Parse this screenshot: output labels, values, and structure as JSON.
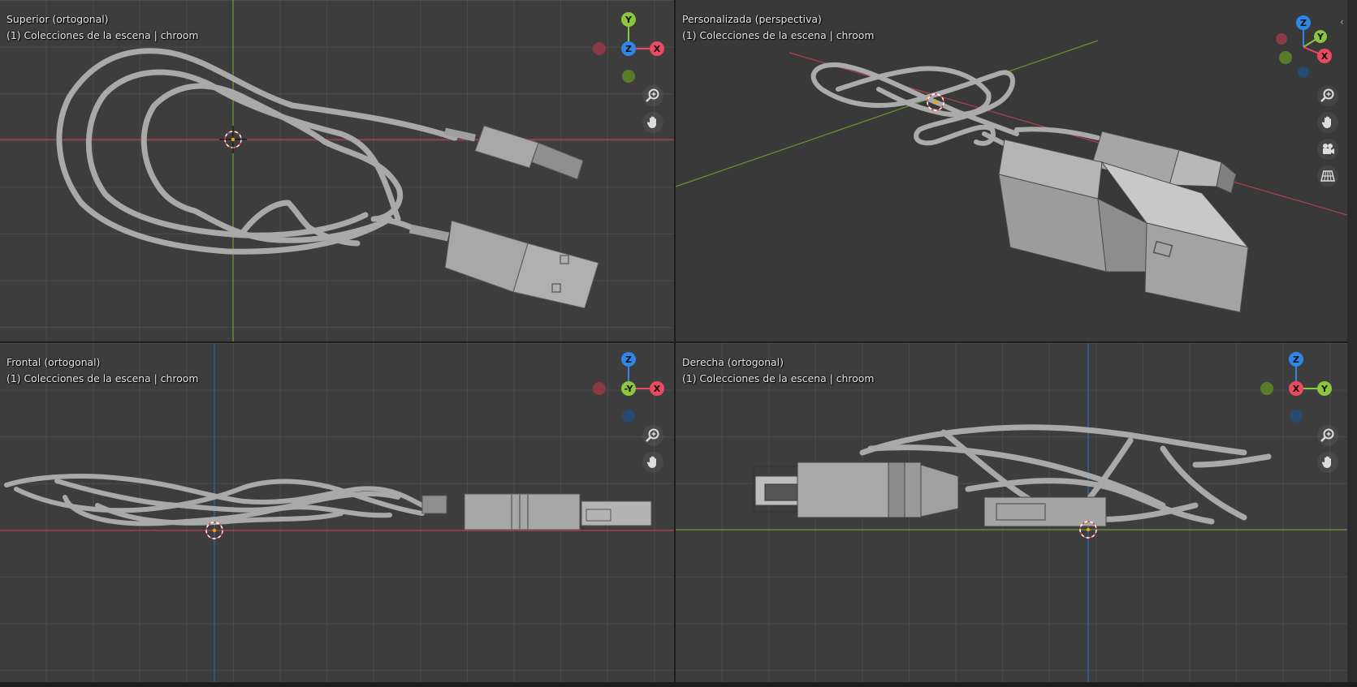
{
  "viewports": {
    "top": {
      "view_name": "Superior (ortogonal)",
      "collection": "(1) Colecciones de la escena | chroom"
    },
    "persp": {
      "view_name": "Personalizada (perspectiva)",
      "collection": "(1) Colecciones de la escena | chroom"
    },
    "front": {
      "view_name": "Frontal (ortogonal)",
      "collection": "(1) Colecciones de la escena | chroom"
    },
    "right": {
      "view_name": "Derecha (ortogonal)",
      "collection": "(1) Colecciones de la escena | chroom"
    }
  },
  "gizmo_labels": {
    "top": {
      "up": "Y",
      "center": "Z",
      "right": "X"
    },
    "persp": {
      "up": "Z",
      "upright": "Y",
      "right": "X"
    },
    "front": {
      "up": "Z",
      "center": "-Y",
      "right": "X"
    },
    "right": {
      "up": "Z",
      "center": "X",
      "right": "Y"
    }
  },
  "icons": [
    "zoom-icon",
    "pan-hand-icon",
    "camera-icon",
    "grid-icon"
  ],
  "colors": {
    "axis_x": "#e84a5f",
    "axis_y": "#8cc63f",
    "axis_z": "#2f86e6",
    "background": "#3d3d3d",
    "object": "#a7a7a7"
  }
}
